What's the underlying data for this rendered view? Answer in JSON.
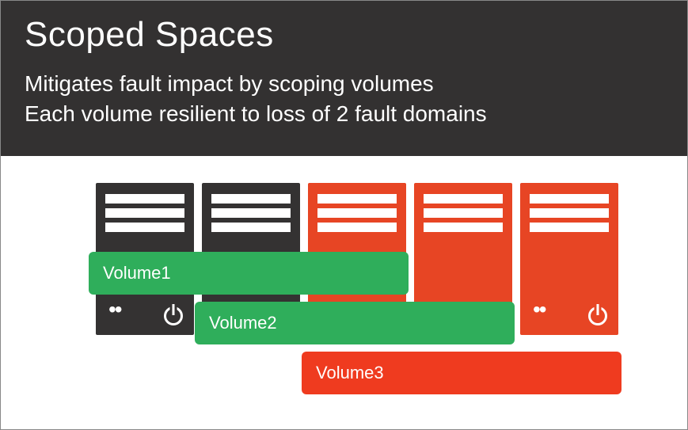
{
  "header": {
    "title": "Scoped Spaces",
    "line1": "Mitigates fault impact by scoping volumes",
    "line2": "Each volume resilient to loss of 2 fault domains"
  },
  "servers": [
    {
      "id": 1,
      "color": "dark"
    },
    {
      "id": 2,
      "color": "dark"
    },
    {
      "id": 3,
      "color": "red"
    },
    {
      "id": 4,
      "color": "red"
    },
    {
      "id": 5,
      "color": "red"
    }
  ],
  "volumes": {
    "v1": {
      "label": "Volume1",
      "span_servers": [
        1,
        2,
        3
      ],
      "style": "green"
    },
    "v2": {
      "label": "Volume2",
      "span_servers": [
        2,
        3,
        4
      ],
      "style": "green"
    },
    "v3": {
      "label": "Volume3",
      "span_servers": [
        3,
        4,
        5
      ],
      "style": "red"
    }
  },
  "icons": {
    "status_dots": "••",
    "power": "power-icon"
  },
  "colors": {
    "header_bg": "#333131",
    "server_dark": "#343232",
    "server_red": "#E74524",
    "volume_green": "#2FAE5B",
    "volume_red": "#EF3B1F"
  }
}
